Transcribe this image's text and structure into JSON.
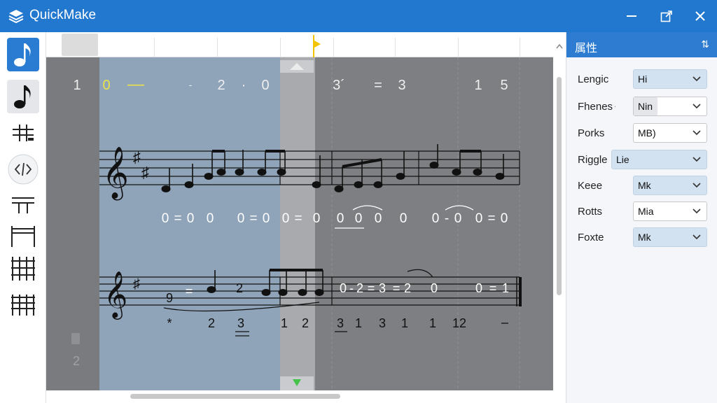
{
  "app": {
    "title": "QuickMake"
  },
  "window": {
    "minimize": "—",
    "maximize": "⧉",
    "close": "✕"
  },
  "toolbar": {
    "tools": [
      {
        "id": "note-input",
        "icon": "eighth-note-icon",
        "state": "selected"
      },
      {
        "id": "note-select",
        "icon": "eighth-note-icon",
        "state": "active"
      },
      {
        "id": "chord",
        "icon": "sharp-chord-icon",
        "state": "normal"
      },
      {
        "id": "code-view",
        "icon": "code-brackets-icon",
        "state": "normal"
      },
      {
        "id": "beam",
        "icon": "beam-icon",
        "state": "normal"
      },
      {
        "id": "measure-grid-2",
        "icon": "grid-2-icon",
        "state": "normal"
      },
      {
        "id": "measure-grid-3",
        "icon": "grid-3-icon",
        "state": "normal"
      },
      {
        "id": "measure-grid-4",
        "icon": "grid-4-icon",
        "state": "normal"
      }
    ]
  },
  "score": {
    "number_row": [
      {
        "text": "1",
        "tone": "white"
      },
      {
        "text": "0",
        "tone": "yellow"
      },
      {
        "text": "—",
        "tone": "yellow"
      },
      {
        "text": "-",
        "tone": "white"
      },
      {
        "text": "2",
        "tone": "white"
      },
      {
        "text": "·",
        "tone": "white"
      },
      {
        "text": "0",
        "tone": "white"
      },
      {
        "text": "3´",
        "tone": "white"
      },
      {
        "text": "=",
        "tone": "white"
      },
      {
        "text": "3",
        "tone": "white"
      },
      {
        "text": "1",
        "tone": "white"
      },
      {
        "text": "5",
        "tone": "white"
      }
    ],
    "staff1_numbers": [
      "0",
      "=",
      "0",
      "0",
      "0",
      "=",
      "0",
      "0",
      "=",
      "0",
      "0",
      "0",
      "0",
      "0",
      "0",
      "-",
      "0",
      "0",
      "=",
      "0"
    ],
    "staff2_numbers": [
      "9",
      "=",
      "2",
      "0",
      "-",
      "2",
      "=",
      "3",
      "=",
      "2",
      "0",
      "0",
      "=",
      "1"
    ],
    "staff2_below": [
      "*",
      "2",
      "3",
      "1",
      "2",
      "3",
      "1",
      "3",
      "1",
      "1",
      "12"
    ],
    "left_markers": [
      "2"
    ]
  },
  "properties": {
    "title": "属性",
    "pin": "⇅",
    "rows": [
      {
        "label": "Lengic",
        "value": "Hi",
        "style": "blue"
      },
      {
        "label": "Fhenes",
        "value": "Nin",
        "style": "white"
      },
      {
        "label": "Porks",
        "value": "MB)",
        "style": "white"
      },
      {
        "label": "Riggle",
        "value": "Lie",
        "style": "blue"
      },
      {
        "label": "Keee",
        "value": "Mk",
        "style": "blue"
      },
      {
        "label": "Rotts",
        "value": "Mia",
        "style": "white"
      },
      {
        "label": "Foxte",
        "value": "Mk",
        "style": "blue"
      }
    ]
  }
}
